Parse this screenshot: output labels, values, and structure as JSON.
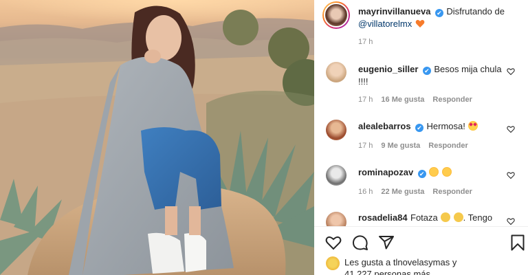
{
  "post": {
    "author": "mayrinvillanueva",
    "caption_text": "Disfrutando de",
    "caption_mention": "@villatorelmx",
    "caption_time": "17 h"
  },
  "comments": [
    {
      "username": "eugenio_siller",
      "verified": true,
      "text_line1": "Besos mija chula",
      "text_line2": "!!!!",
      "time": "17 h",
      "likes": "16 Me gusta",
      "reply": "Responder"
    },
    {
      "username": "alealebarros",
      "verified": true,
      "text_line1": "Hermosa!",
      "time": "17 h",
      "likes": "9 Me gusta",
      "reply": "Responder"
    },
    {
      "username": "rominapozav",
      "verified": true,
      "text_line1": "",
      "time": "16 h",
      "likes": "22 Me gusta",
      "reply": "Responder"
    },
    {
      "username": "rosadelia84",
      "verified": false,
      "text_line1": "Fotaza",
      "text_line1_tail": ". Tengo"
    }
  ],
  "likes": {
    "prefix": "Les gusta a",
    "user": "tlnovelasymas",
    "conj": "y",
    "count_text": "41.227 personas más"
  },
  "icons": {
    "verified": "✔",
    "heart": "heart-icon",
    "comment": "comment-icon",
    "share": "share-icon",
    "save": "bookmark-icon"
  },
  "colors": {
    "verified_blue": "#3897f0",
    "mention_blue": "#00376b",
    "heart_orange": "#f77b2b"
  }
}
